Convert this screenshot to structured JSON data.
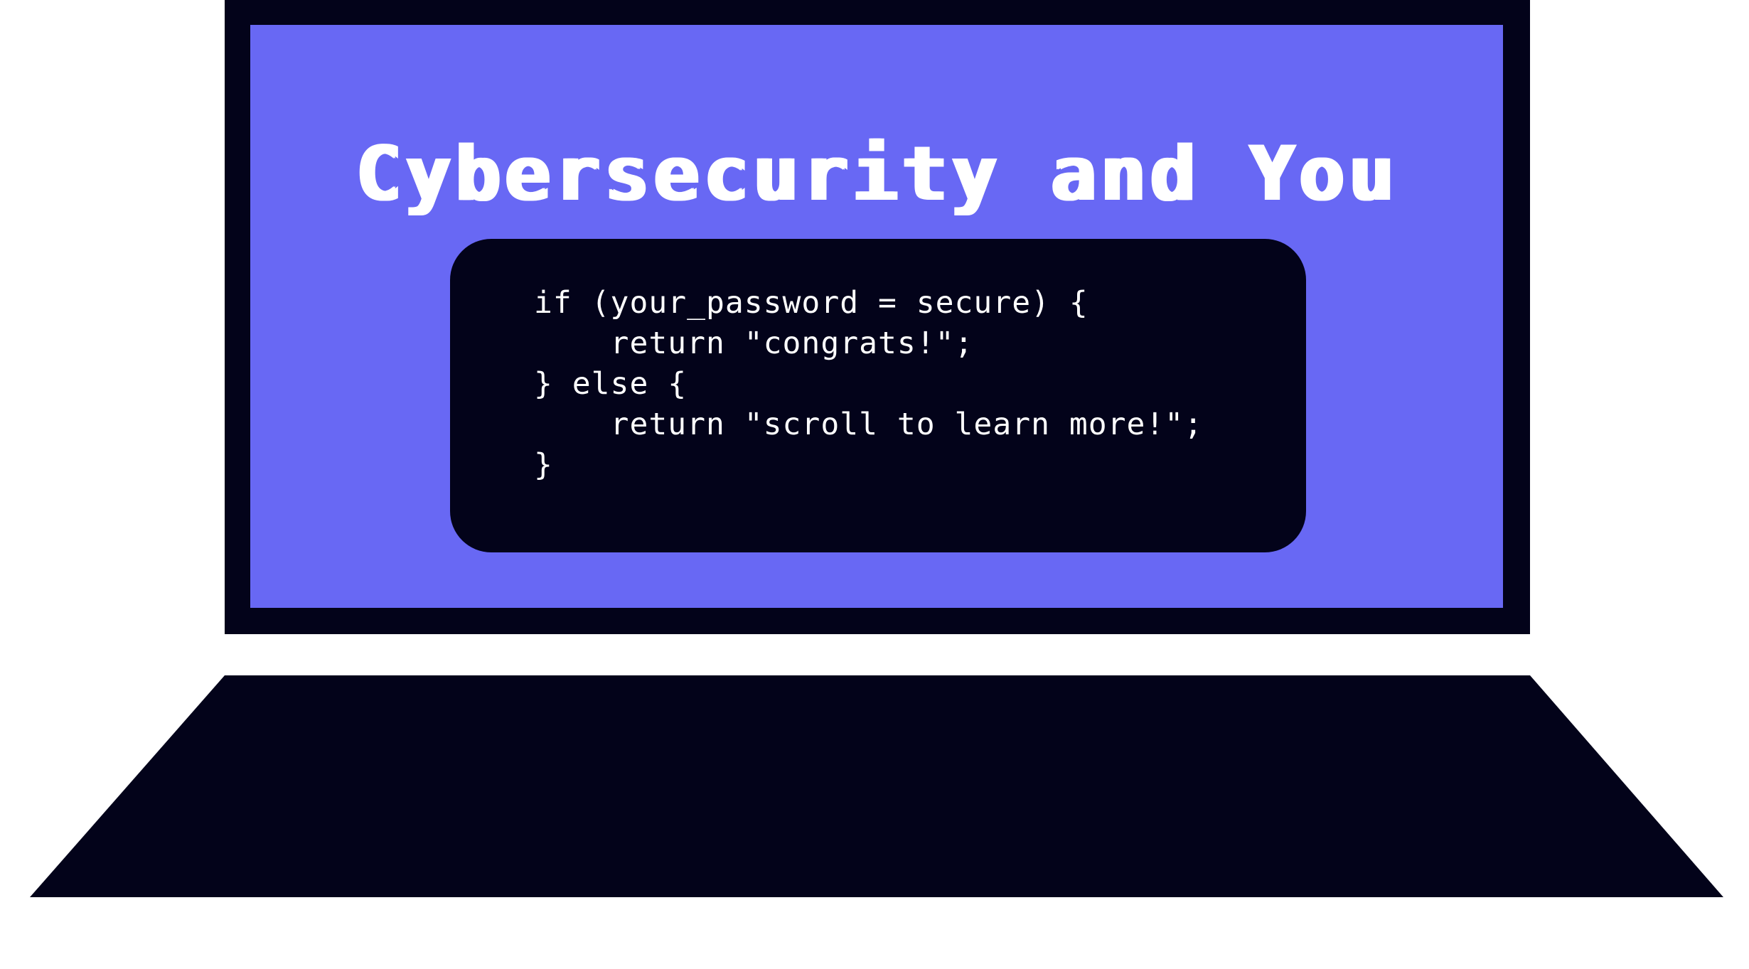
{
  "screen": {
    "title": "Cybersecurity and You",
    "code_lines": [
      "if (your_password = secure) {",
      "    return \"congrats!\";",
      "} else {",
      "    return \"scroll to learn more!\";",
      "}"
    ]
  },
  "colors": {
    "screen_bg": "#6868f4",
    "frame": "#03031a",
    "text": "#ffffff",
    "page_bg": "#ffffff"
  }
}
